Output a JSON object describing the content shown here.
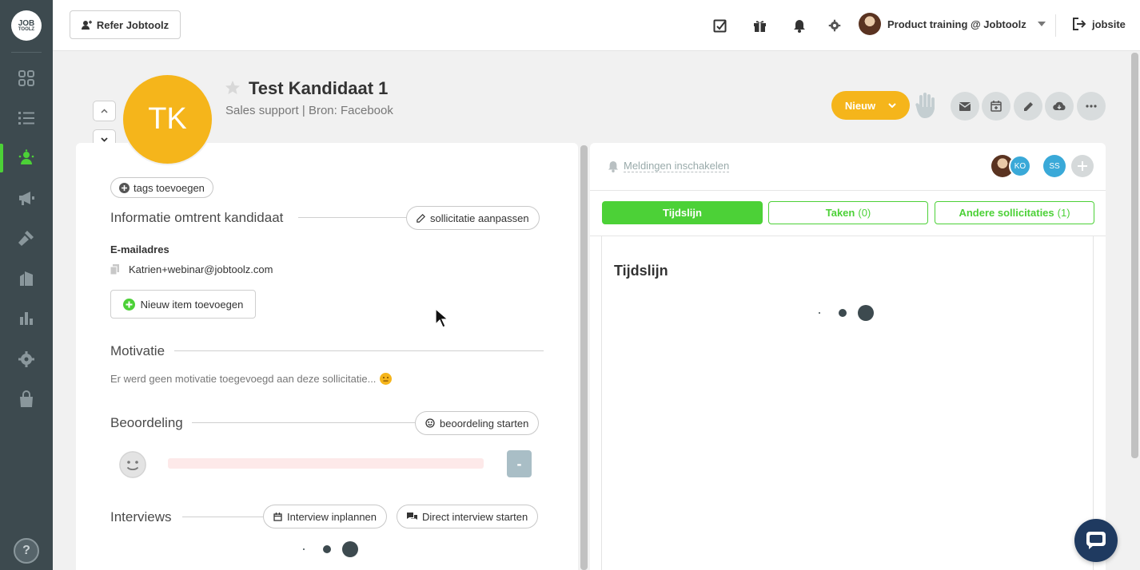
{
  "sidebar": {
    "logo_top": "JOB",
    "logo_bottom": "TOOLZ",
    "items": [
      {
        "icon": "dashboard-icon"
      },
      {
        "icon": "list-icon"
      },
      {
        "icon": "candidates-icon",
        "active": true
      },
      {
        "icon": "megaphone-icon"
      },
      {
        "icon": "hammer-icon"
      },
      {
        "icon": "building-icon"
      },
      {
        "icon": "chart-icon"
      },
      {
        "icon": "gear-icon"
      },
      {
        "icon": "bag-icon"
      }
    ],
    "help_label": "?"
  },
  "topbar": {
    "refer_label": "Refer Jobtoolz",
    "user_name": "Product training @ Jobtoolz",
    "jobsite_label": "jobsite"
  },
  "candidate": {
    "initials": "TK",
    "name": "Test Kandidaat 1",
    "subtitle": "Sales support | Bron: Facebook",
    "status": "Nieuw"
  },
  "left": {
    "tags_label": "tags toevoegen",
    "info_title": "Informatie omtrent kandidaat",
    "edit_label": "sollicitatie aanpassen",
    "email_label": "E-mailadres",
    "email_value": "Katrien+webinar@jobtoolz.com",
    "add_item_label": "Nieuw item toevoegen",
    "motivation_title": "Motivatie",
    "motivation_text": "Er werd geen motivatie toegevoegd aan deze sollicitatie...",
    "rating_title": "Beoordeling",
    "rating_btn": "beoordeling starten",
    "rating_value": "-",
    "interviews_title": "Interviews",
    "interview_plan": "Interview inplannen",
    "interview_direct": "Direct interview starten"
  },
  "right": {
    "notifications_label": "Meldingen inschakelen",
    "avatars": [
      "KO",
      "SS"
    ],
    "tabs": [
      {
        "label": "Tijdslijn",
        "count": ""
      },
      {
        "label": "Taken",
        "count": "(0)"
      },
      {
        "label": "Andere sollicitaties",
        "count": "(1)"
      }
    ],
    "timeline_title": "Tijdslijn"
  },
  "colors": {
    "sidebar": "#3d4a4f",
    "accent_green": "#4cd137",
    "status_yellow": "#f5b51b"
  }
}
